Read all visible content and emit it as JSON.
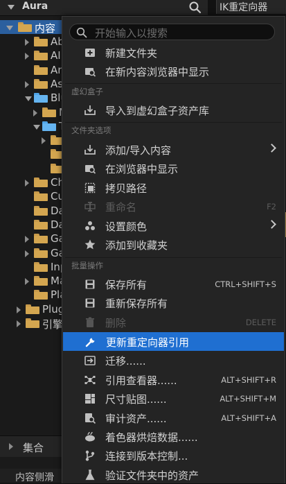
{
  "tree": {
    "header_title": "Aura",
    "root": {
      "label": "内容"
    },
    "items": [
      {
        "label": "Abil",
        "indent": 1,
        "color": "gold",
        "twisty": "right"
      },
      {
        "label": "AI",
        "indent": 1,
        "color": "gold",
        "twisty": "right"
      },
      {
        "label": "Anin",
        "indent": 1,
        "color": "gold",
        "twisty": "none"
      },
      {
        "label": "Ass",
        "indent": 1,
        "color": "gold",
        "twisty": "right"
      },
      {
        "label": "Blue",
        "indent": 1,
        "color": "blue",
        "twisty": "down"
      },
      {
        "label": "M",
        "indent": 2,
        "color": "gold",
        "twisty": "right"
      },
      {
        "label": "Ty",
        "indent": 2,
        "color": "blue",
        "twisty": "down"
      },
      {
        "label": "",
        "indent": 3,
        "color": "gold",
        "twisty": "right"
      },
      {
        "label": "",
        "indent": 3,
        "color": "gold",
        "twisty": "none"
      },
      {
        "label": "",
        "indent": 3,
        "color": "gold",
        "twisty": "none"
      },
      {
        "label": "Cha",
        "indent": 1,
        "color": "gold",
        "twisty": "right"
      },
      {
        "label": "Cur",
        "indent": 1,
        "color": "gold",
        "twisty": "none"
      },
      {
        "label": "Dat",
        "indent": 1,
        "color": "gold",
        "twisty": "none"
      },
      {
        "label": "Dat",
        "indent": 1,
        "color": "gold",
        "twisty": "none"
      },
      {
        "label": "Gan",
        "indent": 1,
        "color": "gold",
        "twisty": "right"
      },
      {
        "label": "Gan",
        "indent": 1,
        "color": "gold",
        "twisty": "right"
      },
      {
        "label": "Inpu",
        "indent": 1,
        "color": "gold",
        "twisty": "none"
      },
      {
        "label": "Map",
        "indent": 1,
        "color": "gold",
        "twisty": "right"
      },
      {
        "label": "Play",
        "indent": 1,
        "color": "gold",
        "twisty": "none"
      },
      {
        "label": "Plugi",
        "indent": 0,
        "color": "gold",
        "twisty": "right"
      },
      {
        "label": "引擎",
        "indent": 0,
        "color": "gold",
        "twisty": "right"
      }
    ],
    "bottom_label": "集合",
    "status_label": "内容侧滑"
  },
  "right_tab": {
    "label": "IK重定向器"
  },
  "menu": {
    "search_placeholder": "开始输入以搜索",
    "sections": {
      "fantasy_box": "虚幻盒子",
      "folder_options": "文件夹选项",
      "bulk_ops": "批量操作"
    },
    "items": [
      {
        "id": "new-folder",
        "label": "新建文件夹",
        "icon": "new-folder-icon",
        "shortcut": "",
        "submenu": false,
        "disabled": false,
        "highlighted": false
      },
      {
        "id": "show-in-new-browser",
        "label": "在新内容浏览器中显示",
        "icon": "folder-search-icon",
        "shortcut": "",
        "submenu": false,
        "disabled": false,
        "highlighted": false
      },
      {
        "id": "import-to-fab",
        "label": "导入到虚幻盒子资产库",
        "icon": "import-box-icon",
        "shortcut": "",
        "submenu": false,
        "disabled": false,
        "highlighted": false
      },
      {
        "id": "add-import",
        "label": "添加/导入内容",
        "icon": "import-icon",
        "shortcut": "",
        "submenu": true,
        "disabled": false,
        "highlighted": false
      },
      {
        "id": "show-in-explorer",
        "label": "在浏览器中显示",
        "icon": "folder-search-icon",
        "shortcut": "",
        "submenu": false,
        "disabled": false,
        "highlighted": false
      },
      {
        "id": "copy-path",
        "label": "拷贝路径",
        "icon": "copy-path-icon",
        "shortcut": "",
        "submenu": false,
        "disabled": false,
        "highlighted": false
      },
      {
        "id": "rename",
        "label": "重命名",
        "icon": "rename-icon",
        "shortcut": "F2",
        "submenu": false,
        "disabled": true,
        "highlighted": false
      },
      {
        "id": "set-color",
        "label": "设置颜色",
        "icon": "palette-icon",
        "shortcut": "",
        "submenu": true,
        "disabled": false,
        "highlighted": false
      },
      {
        "id": "add-favorite",
        "label": "添加到收藏夹",
        "icon": "star-icon",
        "shortcut": "",
        "submenu": false,
        "disabled": false,
        "highlighted": false
      },
      {
        "id": "save-all",
        "label": "保存所有",
        "icon": "save-icon",
        "shortcut": "CTRL+SHIFT+S",
        "submenu": false,
        "disabled": false,
        "highlighted": false
      },
      {
        "id": "resave-all",
        "label": "重新保存所有",
        "icon": "save-icon",
        "shortcut": "",
        "submenu": false,
        "disabled": false,
        "highlighted": false
      },
      {
        "id": "delete",
        "label": "删除",
        "icon": "trash-icon",
        "shortcut": "DELETE",
        "submenu": false,
        "disabled": true,
        "highlighted": false
      },
      {
        "id": "fix-redirectors",
        "label": "更新重定向器引用",
        "icon": "wrench-icon",
        "shortcut": "",
        "submenu": false,
        "disabled": false,
        "highlighted": true
      },
      {
        "id": "migrate",
        "label": "迁移......",
        "icon": "migrate-icon",
        "shortcut": "",
        "submenu": false,
        "disabled": false,
        "highlighted": false
      },
      {
        "id": "reference-viewer",
        "label": "引用查看器......",
        "icon": "reference-viewer-icon",
        "shortcut": "ALT+SHIFT+R",
        "submenu": false,
        "disabled": false,
        "highlighted": false
      },
      {
        "id": "size-map",
        "label": "尺寸贴图......",
        "icon": "size-map-icon",
        "shortcut": "ALT+SHIFT+M",
        "submenu": false,
        "disabled": false,
        "highlighted": false
      },
      {
        "id": "audit-assets",
        "label": "审计资产......",
        "icon": "audit-icon",
        "shortcut": "ALT+SHIFT+A",
        "submenu": false,
        "disabled": false,
        "highlighted": false
      },
      {
        "id": "shader-cook",
        "label": "着色器烘焙数据......",
        "icon": "shader-icon",
        "shortcut": "",
        "submenu": false,
        "disabled": false,
        "highlighted": false
      },
      {
        "id": "connect-source-control",
        "label": "连接到版本控制...",
        "icon": "branch-icon",
        "shortcut": "",
        "submenu": false,
        "disabled": false,
        "highlighted": false
      },
      {
        "id": "validate-assets",
        "label": "验证文件夹中的资产",
        "icon": "flask-icon",
        "shortcut": "",
        "submenu": false,
        "disabled": false,
        "highlighted": false
      }
    ]
  },
  "colors": {
    "highlight": "#1f6fd1",
    "folder_gold": "#d4a650",
    "folder_blue": "#65b4f0",
    "selection": "#2b5f9e"
  }
}
